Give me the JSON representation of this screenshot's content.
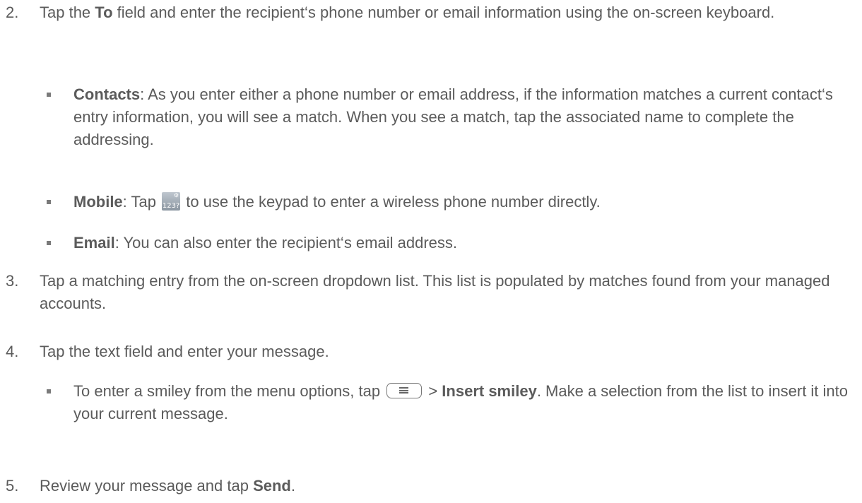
{
  "step2": {
    "number": "2.",
    "pre": "Tap the ",
    "bold": "To",
    "post": " field and enter the recipient‘s phone number or email information using the on-screen keyboard."
  },
  "bullet_contacts": {
    "bold": "Contacts",
    "text": ": As you enter either a phone number or email address, if the information matches a current contact‘s entry information, you will see a match. When you see a match, tap the associated name to complete the addressing."
  },
  "bullet_mobile": {
    "bold": "Mobile",
    "pre": ": Tap ",
    "icon_label": "123?",
    "icon_name": "keypad-icon",
    "post": " to use the keypad to enter a wireless phone number directly."
  },
  "bullet_email": {
    "bold": "Email",
    "text": ": You can also enter the recipient‘s email address."
  },
  "step3": {
    "number": "3.",
    "text": "Tap a matching entry from the on-screen dropdown list. This list is populated by matches found from your managed accounts."
  },
  "step4": {
    "number": "4.",
    "text": "Tap the text field and enter your message."
  },
  "bullet_smiley": {
    "pre": "To enter a smiley from the menu options, tap ",
    "icon_name": "menu-key-icon",
    "mid": " > ",
    "bold": "Insert smiley",
    "post": ". Make a selection from the list to insert it into your current message."
  },
  "step5": {
    "number": "5.",
    "pre": "Review your message and tap ",
    "bold": "Send",
    "post": "."
  }
}
